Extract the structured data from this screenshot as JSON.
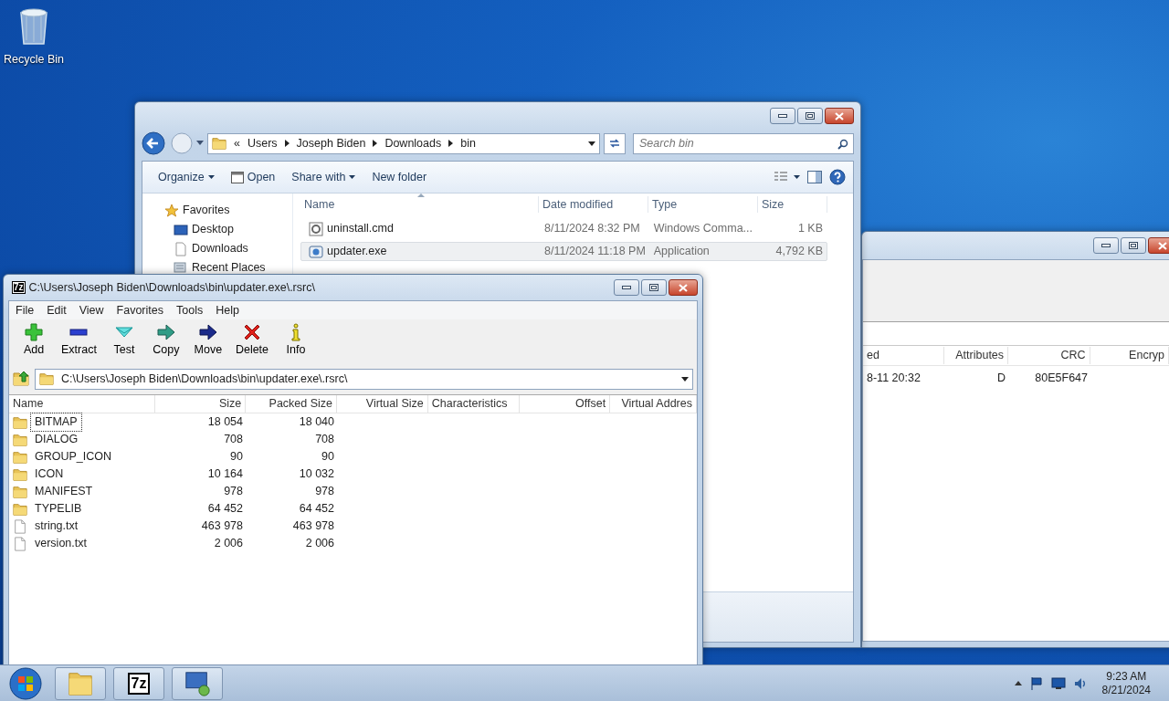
{
  "desktop_icons": [
    {
      "label": "Recycle Bin",
      "kind": "recycle-bin"
    }
  ],
  "back_window": {
    "columns": [
      "ed",
      "Attributes",
      "CRC",
      "Encryp"
    ],
    "rows": [
      {
        "cells": [
          "8-11 20:32",
          "D",
          "80E5F647"
        ]
      }
    ]
  },
  "explorer": {
    "overflow": "«",
    "breadcrumb": [
      "Users",
      "Joseph Biden",
      "Downloads",
      "bin"
    ],
    "search": {
      "placeholder": "Search bin"
    },
    "commands": [
      {
        "label": "Organize",
        "kind": "menu"
      },
      {
        "label": "Open",
        "kind": "open"
      },
      {
        "label": "Share with",
        "kind": "menu"
      },
      {
        "label": "New folder",
        "kind": "plain"
      }
    ],
    "nav": [
      {
        "label": "Favorites",
        "kind": "favorites"
      },
      {
        "label": "Desktop",
        "kind": "desktop"
      },
      {
        "label": "Downloads",
        "kind": "downloads"
      },
      {
        "label": "Recent Places",
        "kind": "recent"
      }
    ],
    "columns": [
      "Name",
      "Date modified",
      "Type",
      "Size"
    ],
    "rows": [
      {
        "name": "uninstall.cmd",
        "kind": "script",
        "date": "8/11/2024 8:32 PM",
        "type": "Windows Comma...",
        "size": "1 KB",
        "selected": false
      },
      {
        "name": "updater.exe",
        "kind": "app",
        "date": "8/11/2024 11:18 PM",
        "type": "Application",
        "size": "4,792 KB",
        "selected": true
      }
    ]
  },
  "archive": {
    "icon_text": "7z",
    "title": "C:\\Users\\Joseph Biden\\Downloads\\bin\\updater.exe\\.rsrc\\",
    "menu": [
      "File",
      "Edit",
      "View",
      "Favorites",
      "Tools",
      "Help"
    ],
    "tools": [
      {
        "label": "Add",
        "kind": "add"
      },
      {
        "label": "Extract",
        "kind": "extract"
      },
      {
        "label": "Test",
        "kind": "test"
      },
      {
        "label": "Copy",
        "kind": "copy"
      },
      {
        "label": "Move",
        "kind": "move"
      },
      {
        "label": "Delete",
        "kind": "delete"
      },
      {
        "label": "Info",
        "kind": "info"
      }
    ],
    "path": "C:\\Users\\Joseph Biden\\Downloads\\bin\\updater.exe\\.rsrc\\",
    "columns": [
      "Name",
      "Size",
      "Packed Size",
      "Virtual Size",
      "Characteristics",
      "Offset",
      "Virtual Addres"
    ],
    "rows": [
      {
        "name": "BITMAP",
        "kind": "folder",
        "size": "18 054",
        "packed": "18 040",
        "focused": true
      },
      {
        "name": "DIALOG",
        "kind": "folder",
        "size": "708",
        "packed": "708",
        "focused": false
      },
      {
        "name": "GROUP_ICON",
        "kind": "folder",
        "size": "90",
        "packed": "90",
        "focused": false
      },
      {
        "name": "ICON",
        "kind": "folder",
        "size": "10 164",
        "packed": "10 032",
        "focused": false
      },
      {
        "name": "MANIFEST",
        "kind": "folder",
        "size": "978",
        "packed": "978",
        "focused": false
      },
      {
        "name": "TYPELIB",
        "kind": "folder",
        "size": "64 452",
        "packed": "64 452",
        "focused": false
      },
      {
        "name": "string.txt",
        "kind": "file",
        "size": "463 978",
        "packed": "463 978",
        "focused": false
      },
      {
        "name": "version.txt",
        "kind": "file",
        "size": "2 006",
        "packed": "2 006",
        "focused": false
      }
    ]
  },
  "taskbar": {
    "apps": [
      {
        "kind": "explorer"
      },
      {
        "kind": "archiver",
        "label": "7z"
      },
      {
        "kind": "remote"
      }
    ],
    "clock": {
      "time": "9:23 AM",
      "date": "8/21/2024"
    }
  }
}
